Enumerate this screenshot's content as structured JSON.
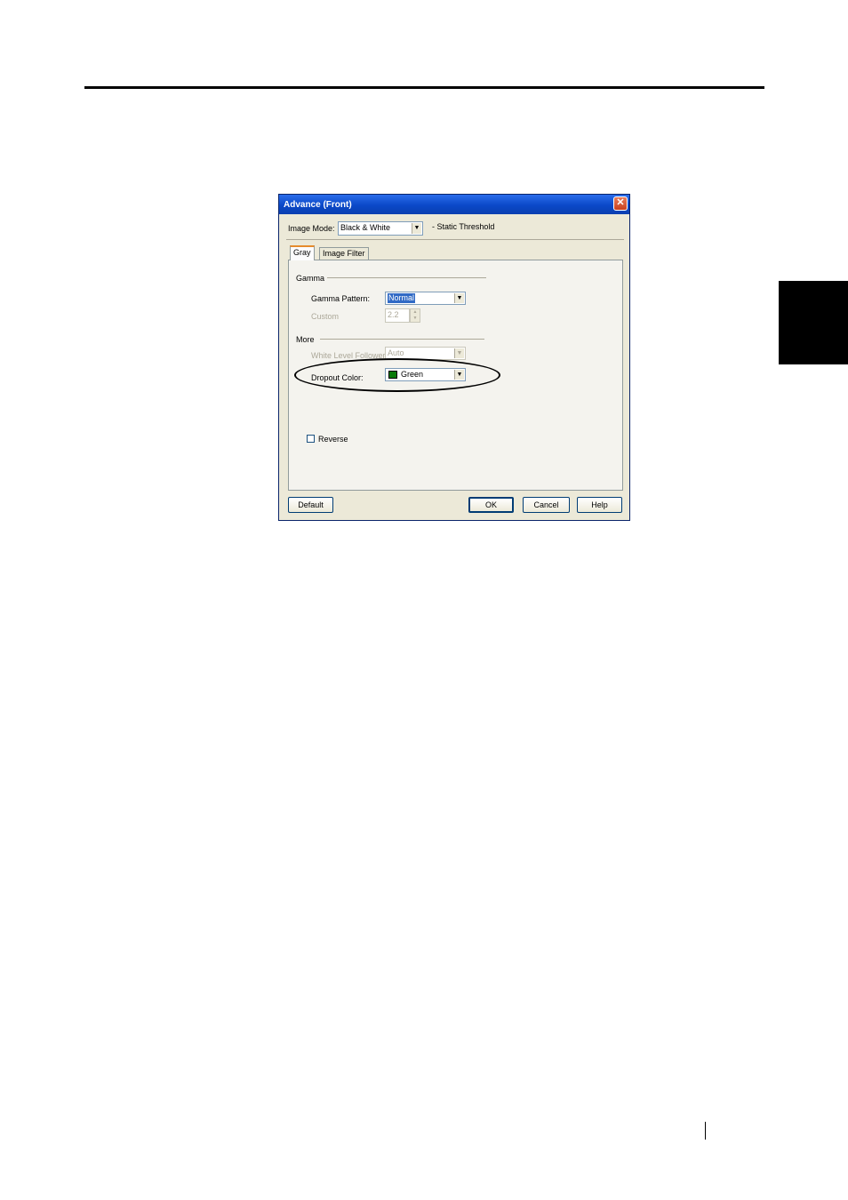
{
  "dialog": {
    "title": "Advance (Front)",
    "image_mode_label": "Image Mode:",
    "image_mode_value": "Black & White",
    "image_mode_note": "- Static Threshold",
    "tabs": [
      {
        "label": "Gray"
      },
      {
        "label": "Image Filter"
      }
    ],
    "gamma": {
      "group_label": "Gamma",
      "pattern_label": "Gamma Pattern:",
      "pattern_value": "Normal",
      "custom_label": "Custom",
      "custom_value": "2.2"
    },
    "more": {
      "group_label": "More",
      "white_level_label": "White Level Follower:",
      "white_level_value": "Auto",
      "dropout_label": "Dropout Color:",
      "dropout_value": "Green",
      "dropout_swatch": "#0a7a0a"
    },
    "reverse_label": "Reverse",
    "buttons": {
      "default": "Default",
      "ok": "OK",
      "cancel": "Cancel",
      "help": "Help"
    }
  },
  "colors": {
    "titlebar": "#0a48c8",
    "dialog_bg": "#ece9d8",
    "selection": "#316ac5"
  }
}
